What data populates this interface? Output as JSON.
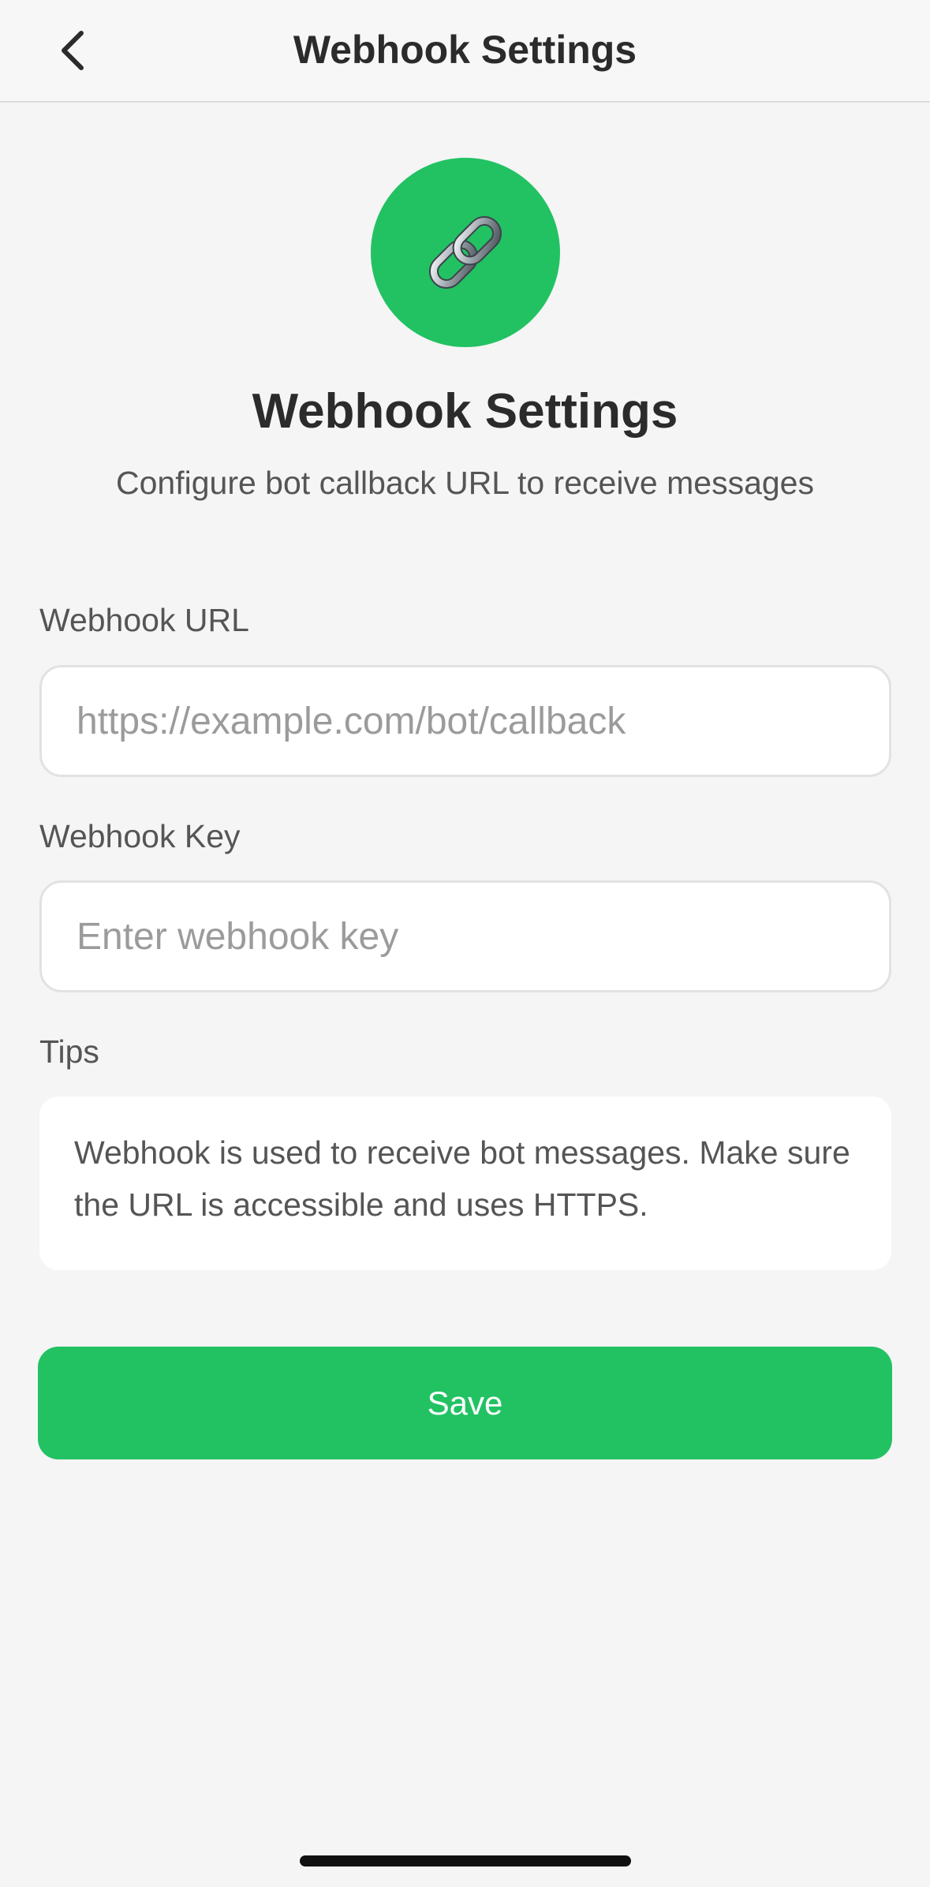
{
  "header": {
    "title": "Webhook Settings",
    "back_icon": "chevron-left-icon"
  },
  "hero": {
    "icon": "link-icon",
    "icon_color": "#22c263",
    "title": "Webhook Settings",
    "subtitle": "Configure bot callback URL to receive messages"
  },
  "form": {
    "url": {
      "label": "Webhook URL",
      "value": "",
      "placeholder": "https://example.com/bot/callback"
    },
    "key": {
      "label": "Webhook Key",
      "value": "",
      "placeholder": "Enter webhook key"
    },
    "tips": {
      "label": "Tips",
      "text": "Webhook is used to receive bot messages. Make sure the URL is accessible and uses HTTPS."
    }
  },
  "actions": {
    "save_label": "Save",
    "accent_color": "#22c263"
  }
}
